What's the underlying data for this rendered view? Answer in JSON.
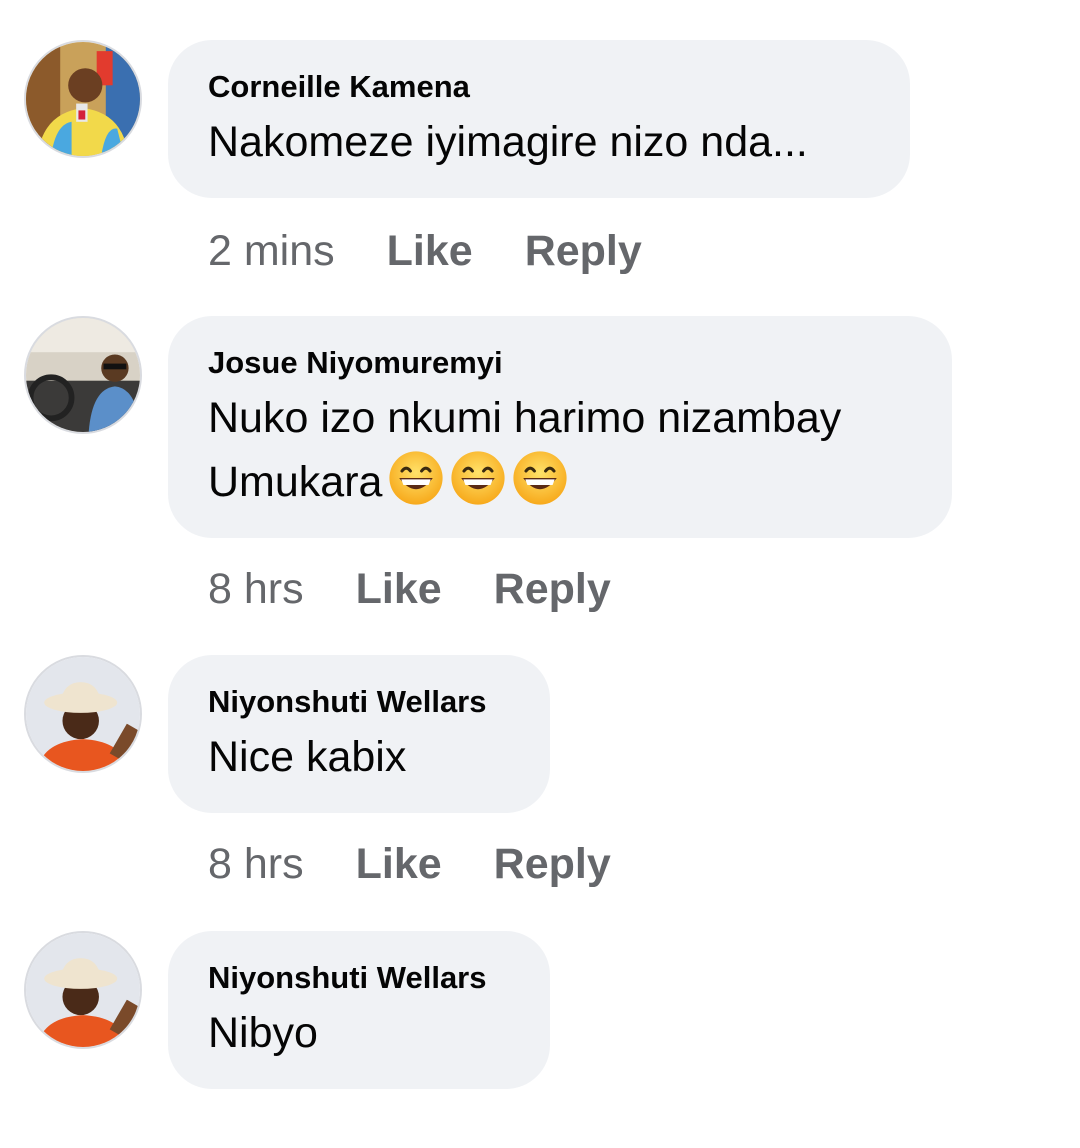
{
  "comments": [
    {
      "author": "Corneille Kamena",
      "text": "Nakomeze iyimagire nizo nda...",
      "time": "2 mins",
      "like_label": "Like",
      "reply_label": "Reply",
      "avatar": "avatar-photo-man-with-microphone"
    },
    {
      "author": "Josue Niyomuremyi",
      "text_line1": "Nuko izo nkumi harimo nizambay",
      "text_line2": "Umukara",
      "emojis": [
        "grinning-face-emoji",
        "grinning-face-emoji",
        "grinning-face-emoji"
      ],
      "time": "8 hrs",
      "like_label": "Like",
      "reply_label": "Reply",
      "avatar": "avatar-photo-man-in-car"
    },
    {
      "author": "Niyonshuti Wellars",
      "text": "Nice kabix",
      "time": "8 hrs",
      "like_label": "Like",
      "reply_label": "Reply",
      "avatar": "avatar-photo-man-with-hat"
    },
    {
      "author": "Niyonshuti Wellars",
      "text": "Nibyo",
      "avatar": "avatar-photo-man-with-hat"
    }
  ],
  "colors": {
    "bubble_bg": "#f0f2f5",
    "text": "#050505",
    "meta": "#65676b"
  }
}
